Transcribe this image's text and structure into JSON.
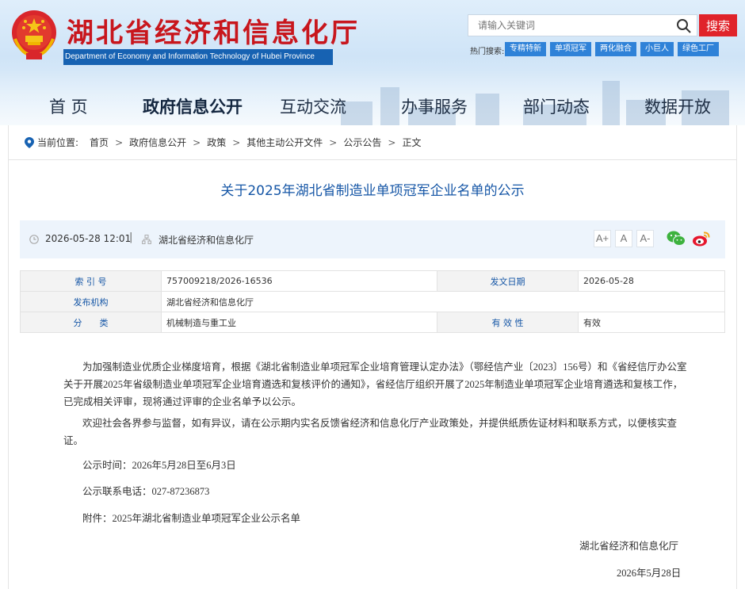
{
  "header": {
    "title": "湖北省经济和信息化厅",
    "subtitle": "Department of Economy and Information Technology of Hubei Province",
    "search_placeholder": "请输入关键词",
    "search_button": "搜索",
    "hot_label": "热门搜索:",
    "hot_tags": [
      "专精特新",
      "单项冠军",
      "两化融合",
      "小巨人",
      "绿色工厂"
    ],
    "brand_color": "#c8161d"
  },
  "nav": {
    "items": [
      "首 页",
      "政府信息公开",
      "互动交流",
      "办事服务",
      "部门动态",
      "数据开放"
    ],
    "active": "政府信息公开"
  },
  "breadcrumb": {
    "label": "当前位置:",
    "items": [
      "首页",
      "政府信息公开",
      "政策",
      "其他主动公开文件",
      "公示公告",
      "正文"
    ],
    "separator": ">"
  },
  "article": {
    "title": "关于2025年湖北省制造业单项冠军企业名单的公示",
    "date": "2026-05-28 12:01",
    "meta_separator": "|",
    "source": "湖北省经济和信息化厅",
    "font_sizes": [
      "A+",
      "A",
      "A-"
    ],
    "share": [
      "wechat-icon",
      "weibo-icon"
    ]
  },
  "info": {
    "index_label": "索 引 号",
    "index_value": "757009218/2026-16536",
    "issue_date_label": "发文日期",
    "issue_date_value": "2026-05-28",
    "publisher_label": "发布机构",
    "publisher_value": "湖北省经济和信息化厅",
    "category_label": "分　　类",
    "category_value": "机械制造与重工业",
    "validity_label": "有 效 性",
    "validity_value": "有效"
  },
  "body": {
    "p1": "为加强制造业优质企业梯度培育，根据《湖北省制造业单项冠军企业培育管理认定办法》（鄂经信产业〔2023〕156号）和《省经信厅办公室关于开展2025年省级制造业单项冠军企业培育遴选和复核评价的通知》，省经信厅组织开展了2025年制造业单项冠军企业培育遴选和复核工作，已完成相关评审，现将通过评审的企业名单予以公示。",
    "p2": "欢迎社会各界参与监督，如有异议，请在公示期内实名反馈省经济和信息化厅产业政策处，并提供纸质佐证材料和联系方式，以便核实查证。",
    "p3": "公示时间：2026年5月28日至6月3日",
    "p4": "公示联系电话：027-87236873",
    "p5": "附件：2025年湖北省制造业单项冠军企业公示名单",
    "sign_org": "湖北省经济和信息化厅",
    "sign_date": "2026年5月28日"
  }
}
